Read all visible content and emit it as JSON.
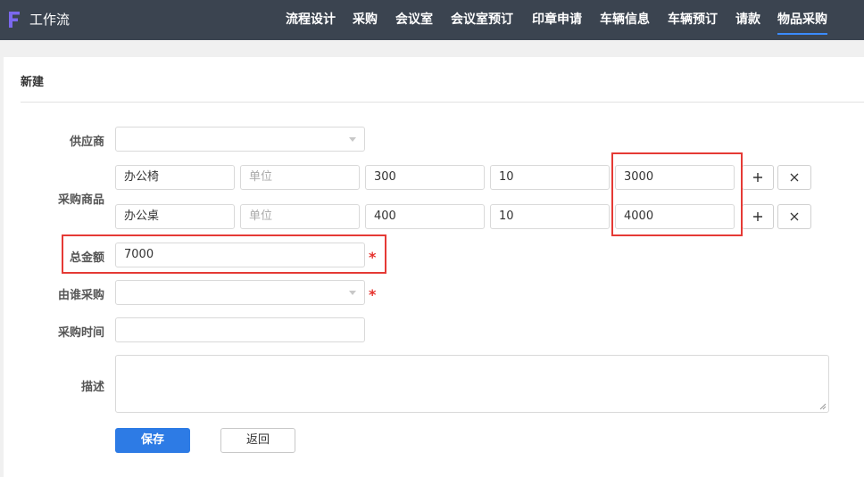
{
  "app": {
    "logo_letter": "F",
    "title": "工作流"
  },
  "nav": [
    "流程设计",
    "采购",
    "会议室",
    "会议室预订",
    "印章申请",
    "车辆信息",
    "车辆预订",
    "请款",
    "物品采购"
  ],
  "active_nav": "物品采购",
  "colors": {
    "topbar": "#3b4450",
    "accent": "#2d7be5",
    "required": "#e5302b",
    "highlight_box": "#e53a35",
    "logo": "#7b68ee"
  },
  "form": {
    "title": "新建",
    "supplier": {
      "label": "供应商",
      "value": ""
    },
    "items_label": "采购商品",
    "items": [
      {
        "name": "办公椅",
        "unit_placeholder": "单位",
        "price": "300",
        "qty": "10",
        "total": "3000"
      },
      {
        "name": "办公桌",
        "unit_placeholder": "单位",
        "price": "400",
        "qty": "10",
        "total": "4000"
      }
    ],
    "add_icon": "plus-icon",
    "remove_icon": "close-icon",
    "total_amount": {
      "label": "总金额",
      "value": "7000",
      "required_mark": "*"
    },
    "purchaser": {
      "label": "由谁采购",
      "value": "",
      "required_mark": "*"
    },
    "purchase_time": {
      "label": "采购时间",
      "value": ""
    },
    "description": {
      "label": "描述",
      "value": ""
    },
    "save_label": "保存",
    "back_label": "返回"
  }
}
